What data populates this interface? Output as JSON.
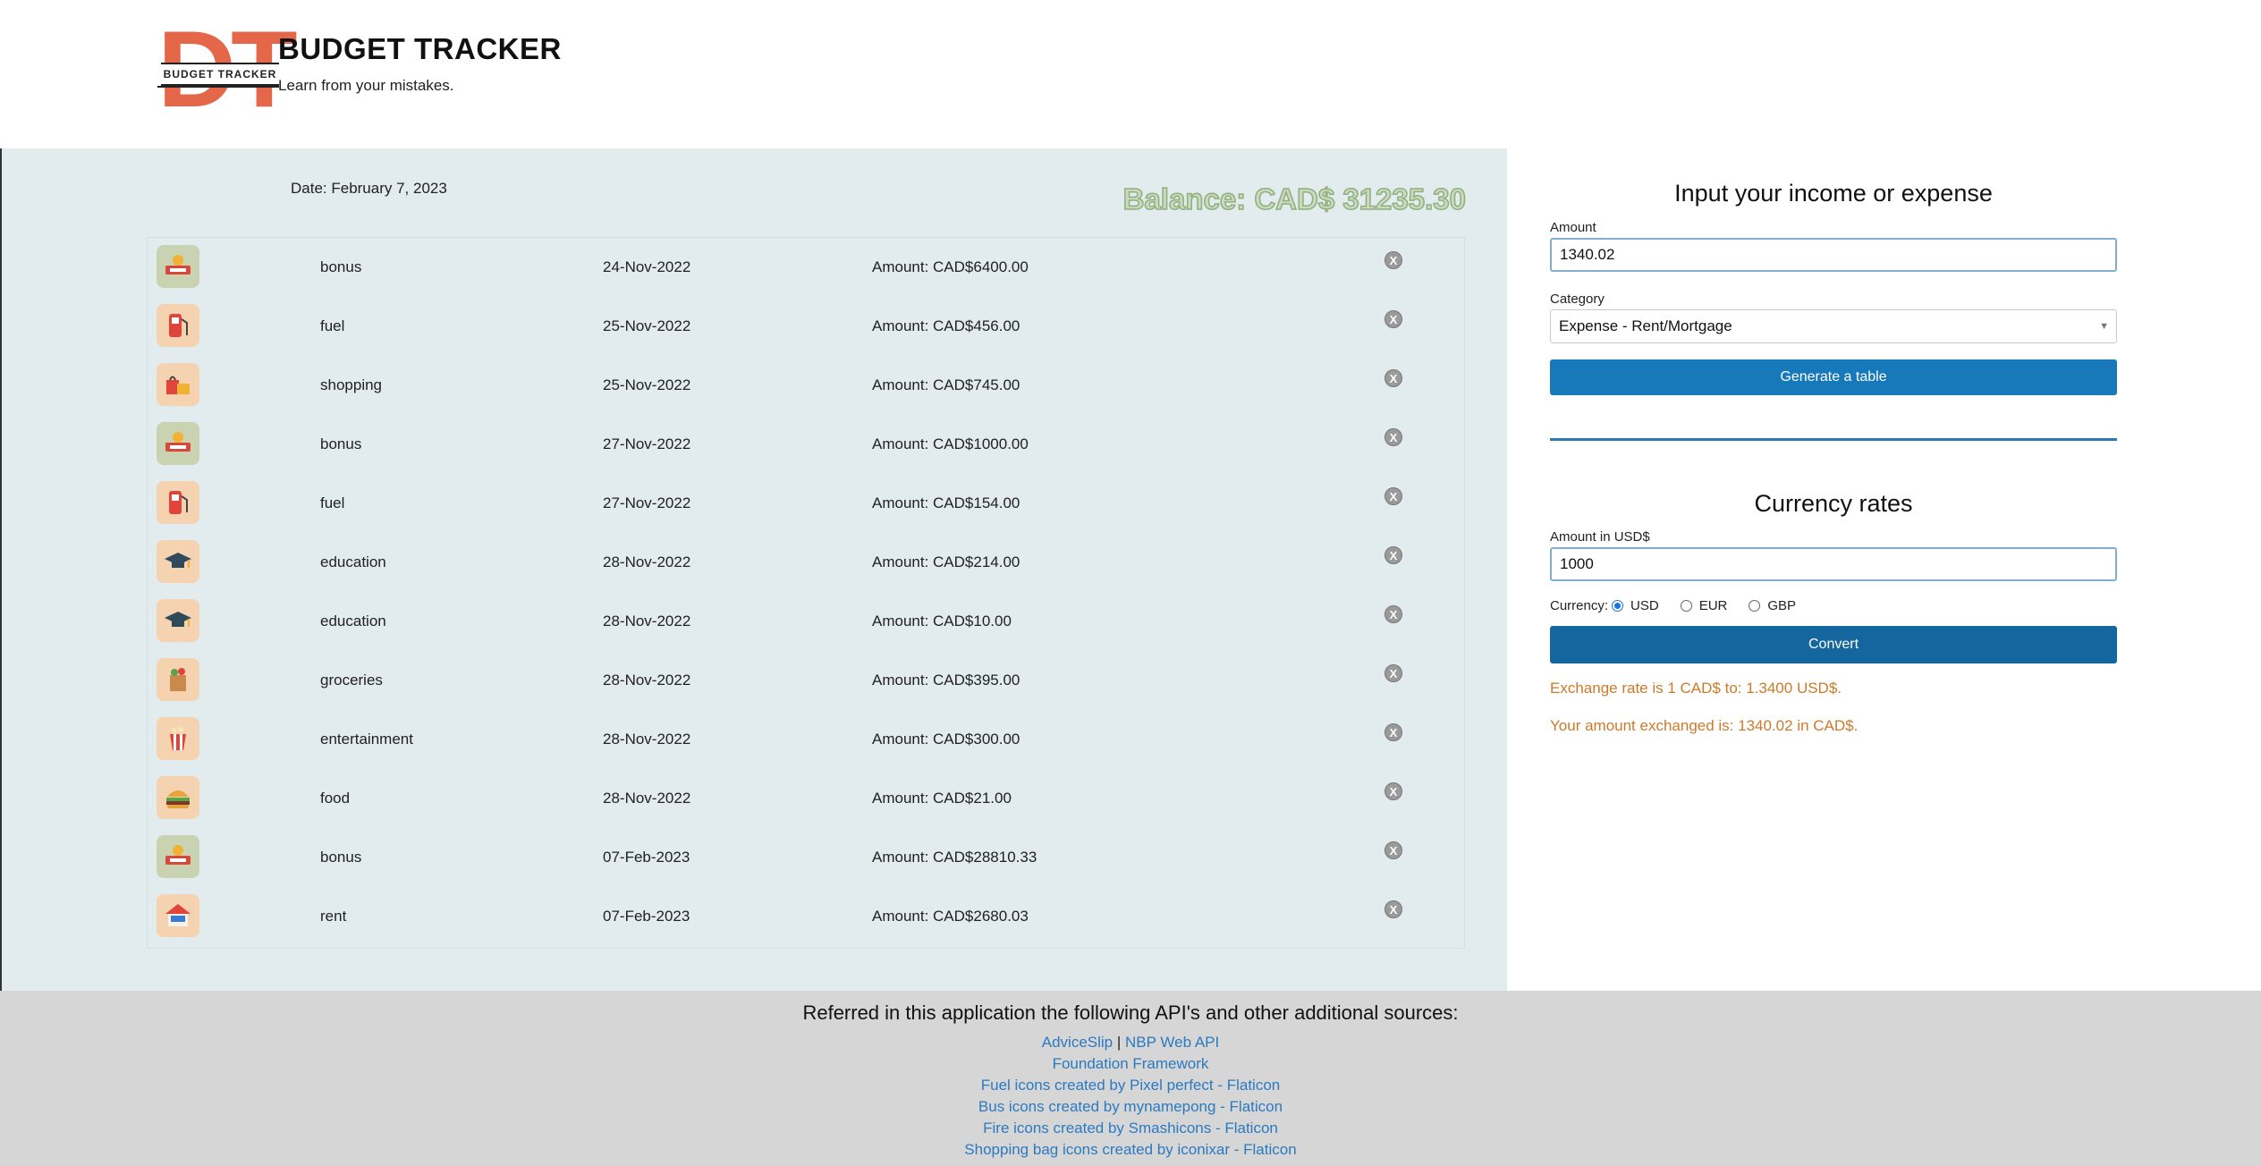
{
  "header": {
    "logo_letters": "DT",
    "logo_band": "BUDGET TRACKER",
    "title": "BUDGET TRACKER",
    "tagline": "Learn from your mistakes."
  },
  "left": {
    "date": "Date: February 7, 2023",
    "balance": "Balance: CAD$ 31235.30",
    "delete_label": "X",
    "rows": [
      {
        "icon": "bonus-icon",
        "name": "bonus",
        "date": "24-Nov-2022",
        "amount": "Amount: CAD$6400.00"
      },
      {
        "icon": "fuel-icon",
        "name": "fuel",
        "date": "25-Nov-2022",
        "amount": "Amount: CAD$456.00"
      },
      {
        "icon": "shopping-icon",
        "name": "shopping",
        "date": "25-Nov-2022",
        "amount": "Amount: CAD$745.00"
      },
      {
        "icon": "bonus-icon",
        "name": "bonus",
        "date": "27-Nov-2022",
        "amount": "Amount: CAD$1000.00"
      },
      {
        "icon": "fuel-icon",
        "name": "fuel",
        "date": "27-Nov-2022",
        "amount": "Amount: CAD$154.00"
      },
      {
        "icon": "education-icon",
        "name": "education",
        "date": "28-Nov-2022",
        "amount": "Amount: CAD$214.00"
      },
      {
        "icon": "education-icon",
        "name": "education",
        "date": "28-Nov-2022",
        "amount": "Amount: CAD$10.00"
      },
      {
        "icon": "groceries-icon",
        "name": "groceries",
        "date": "28-Nov-2022",
        "amount": "Amount: CAD$395.00"
      },
      {
        "icon": "entertainment-icon",
        "name": "entertainment",
        "date": "28-Nov-2022",
        "amount": "Amount: CAD$300.00"
      },
      {
        "icon": "food-icon",
        "name": "food",
        "date": "28-Nov-2022",
        "amount": "Amount: CAD$21.00"
      },
      {
        "icon": "bonus-icon",
        "name": "bonus",
        "date": "07-Feb-2023",
        "amount": "Amount: CAD$28810.33"
      },
      {
        "icon": "rent-icon",
        "name": "rent",
        "date": "07-Feb-2023",
        "amount": "Amount: CAD$2680.03"
      }
    ]
  },
  "form": {
    "title": "Input your income or expense",
    "amount_label": "Amount",
    "amount_value": "1340.02",
    "category_label": "Category",
    "category_value": "Expense - Rent/Mortgage",
    "generate_label": "Generate a table"
  },
  "currency": {
    "title": "Currency rates",
    "amount_label": "Amount in USD$",
    "amount_value": "1000",
    "currency_label": "Currency:",
    "options": [
      "USD",
      "EUR",
      "GBP"
    ],
    "selected": "USD",
    "convert_label": "Convert",
    "rate_text": "Exchange rate is 1 CAD$ to: 1.3400 USD$.",
    "exchanged_text": "Your amount exchanged is: 1340.02 in CAD$."
  },
  "footer": {
    "title": "Referred in this application the following API's and other additional sources:",
    "link_advice": "AdviceSlip",
    "separator": "|",
    "link_nbp": "NBP Web API",
    "links": [
      "Foundation Framework",
      "Fuel icons created by Pixel perfect - Flaticon",
      "Bus icons created by mynamepong - Flaticon",
      "Fire icons created by Smashicons - Flaticon",
      "Shopping bag icons created by iconixar - Flaticon"
    ]
  },
  "colors": {
    "accent": "#1779ba",
    "panel_bg": "#e2ebee",
    "footer_bg": "#d6d6d6",
    "note": "#cc7a2a",
    "logo": "#e4674a"
  }
}
